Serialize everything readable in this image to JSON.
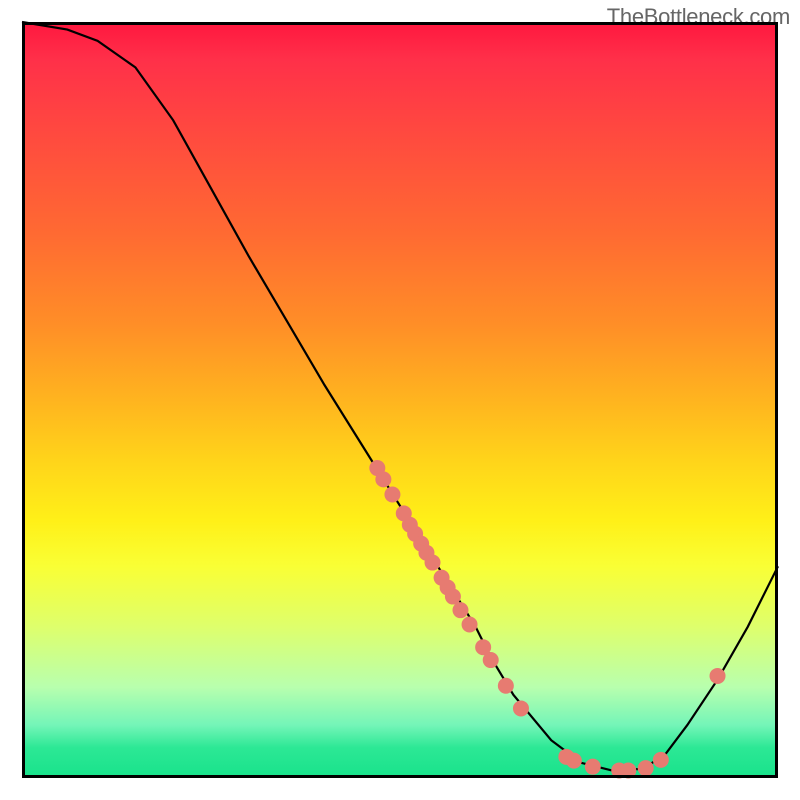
{
  "watermark": "TheBottleneck.com",
  "chart_data": {
    "type": "line",
    "title": "",
    "xlabel": "",
    "ylabel": "",
    "xlim": [
      0,
      100
    ],
    "ylim": [
      0,
      100
    ],
    "series": [
      {
        "name": "curve",
        "x": [
          0,
          6,
          10,
          15,
          20,
          25,
          30,
          35,
          40,
          45,
          50,
          55,
          60,
          62,
          65,
          70,
          74,
          78,
          82,
          85,
          88,
          92,
          96,
          100
        ],
        "y": [
          100,
          99,
          97.5,
          94,
          87,
          78,
          69,
          60.5,
          52,
          44,
          36,
          28,
          20,
          16,
          11,
          5,
          2,
          1,
          1.2,
          3,
          7,
          13,
          20,
          28
        ]
      }
    ],
    "markers": [
      {
        "x": 47,
        "y": 41
      },
      {
        "x": 47.8,
        "y": 39.5
      },
      {
        "x": 49.0,
        "y": 37.5
      },
      {
        "x": 50.5,
        "y": 35
      },
      {
        "x": 51.3,
        "y": 33.5
      },
      {
        "x": 52.0,
        "y": 32.3
      },
      {
        "x": 52.8,
        "y": 31.0
      },
      {
        "x": 53.5,
        "y": 29.8
      },
      {
        "x": 54.3,
        "y": 28.5
      },
      {
        "x": 55.5,
        "y": 26.5
      },
      {
        "x": 56.3,
        "y": 25.2
      },
      {
        "x": 57.0,
        "y": 24.0
      },
      {
        "x": 58.0,
        "y": 22.2
      },
      {
        "x": 59.2,
        "y": 20.3
      },
      {
        "x": 61.0,
        "y": 17.3
      },
      {
        "x": 62.0,
        "y": 15.6
      },
      {
        "x": 64.0,
        "y": 12.2
      },
      {
        "x": 66.0,
        "y": 9.2
      },
      {
        "x": 72.0,
        "y": 2.8
      },
      {
        "x": 73.0,
        "y": 2.3
      },
      {
        "x": 75.5,
        "y": 1.5
      },
      {
        "x": 79.0,
        "y": 1.0
      },
      {
        "x": 80.2,
        "y": 1.0
      },
      {
        "x": 82.5,
        "y": 1.3
      },
      {
        "x": 84.5,
        "y": 2.4
      },
      {
        "x": 92.0,
        "y": 13.5
      }
    ]
  }
}
